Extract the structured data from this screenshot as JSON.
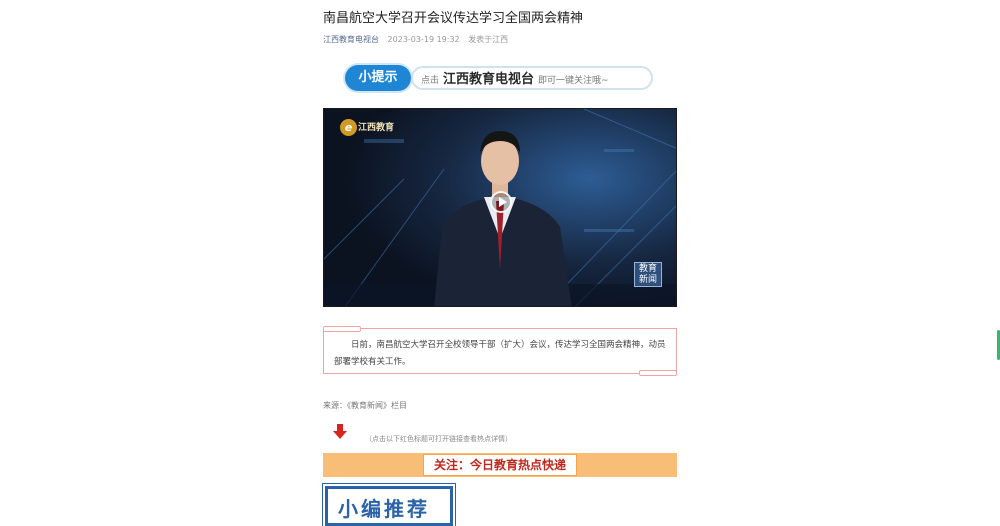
{
  "article": {
    "title": "南昌航空大学召开会议传达学习全国两会精神",
    "account": "江西教育电视台",
    "datetime": "2023-03-19 19:32",
    "location": "发表于江西"
  },
  "tip": {
    "badge": "小提示",
    "prefix": "点击",
    "brand": "江西教育电视台",
    "suffix": "即可一键关注哦~"
  },
  "video": {
    "channel_logo": "江西教育",
    "news_badge_line1": "教育",
    "news_badge_line2": "新闻",
    "play_icon": "play-icon"
  },
  "summary": {
    "text": "日前，南昌航空大学召开全校领导干部（扩大）会议，传达学习全国两会精神，动员部署学校有关工作。"
  },
  "source": "来源：《教育新闻》栏目",
  "hint": "（点击以下红色标题可打开链接查看热点详情）",
  "hot": {
    "label": "关注：今日教育热点快递"
  },
  "editor": {
    "label": "小编推荐"
  },
  "colors": {
    "link": "#576b95",
    "tip_blue": "#1f86d6",
    "hot_bar": "#f8bd76",
    "hot_text": "#c0281c",
    "editor_blue": "#2a63a8"
  }
}
